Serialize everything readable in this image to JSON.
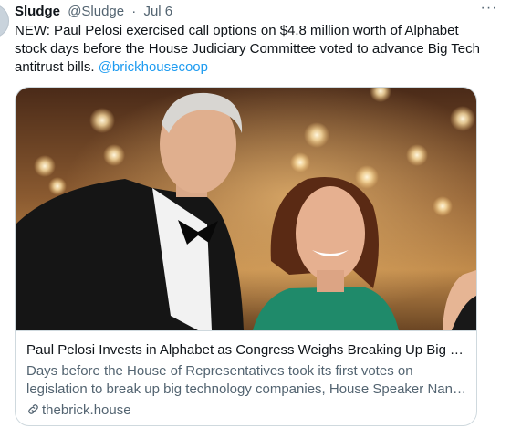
{
  "tweet": {
    "display_name": "Sludge",
    "handle": "@Sludge",
    "separator": "·",
    "date": "Jul 6",
    "more_label": "···",
    "text": "NEW: Paul Pelosi exercised call options on $4.8 million worth of Alphabet stock days before the House Judiciary Committee voted to advance Big Tech antitrust bills. ",
    "mention": "@brickhousecoop"
  },
  "card": {
    "title": "Paul Pelosi Invests in Alphabet as Congress Weighs Breaking Up Big Tech",
    "description_line1": "Days before the House of Representatives took its first votes on",
    "description_line2": "legislation to break up big technology companies, House Speaker Nancy Pelosi",
    "domain": "thebrick.house",
    "image_icon": "photo",
    "link_icon": "link-icon"
  },
  "colors": {
    "accent": "#1d9bf0",
    "text_primary": "#0f1419",
    "text_secondary": "#536471",
    "border": "#cfd9de"
  }
}
